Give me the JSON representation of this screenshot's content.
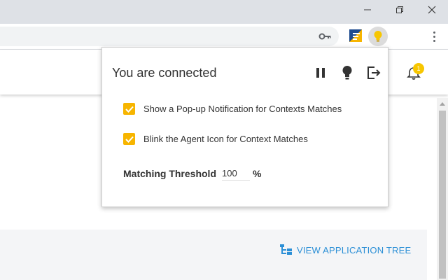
{
  "window_controls": {
    "minimize": "minimize-icon",
    "restore": "restore-icon",
    "close": "close-icon"
  },
  "toolbar": {
    "icons": [
      "key-icon",
      "agent-extension-icon",
      "lightbulb-extension-icon",
      "kebab-menu-icon"
    ]
  },
  "header": {
    "notification_count": "1"
  },
  "popup": {
    "title": "You are connected",
    "icons": [
      "pause-icon",
      "lightbulb-icon",
      "logout-icon"
    ],
    "options": [
      {
        "label": "Show a Pop-up Notification for Contexts Matches",
        "checked": true
      },
      {
        "label": "Blink the Agent Icon for Context Matches",
        "checked": true
      }
    ],
    "threshold": {
      "label": "Matching Threshold",
      "value": "100",
      "unit": "%"
    }
  },
  "panel": {
    "view_tree_label": "VIEW APPLICATION TREE"
  },
  "colors": {
    "accent_yellow": "#f7b500",
    "link_blue": "#2b8fd6",
    "chrome_bg": "#dee1e6"
  }
}
